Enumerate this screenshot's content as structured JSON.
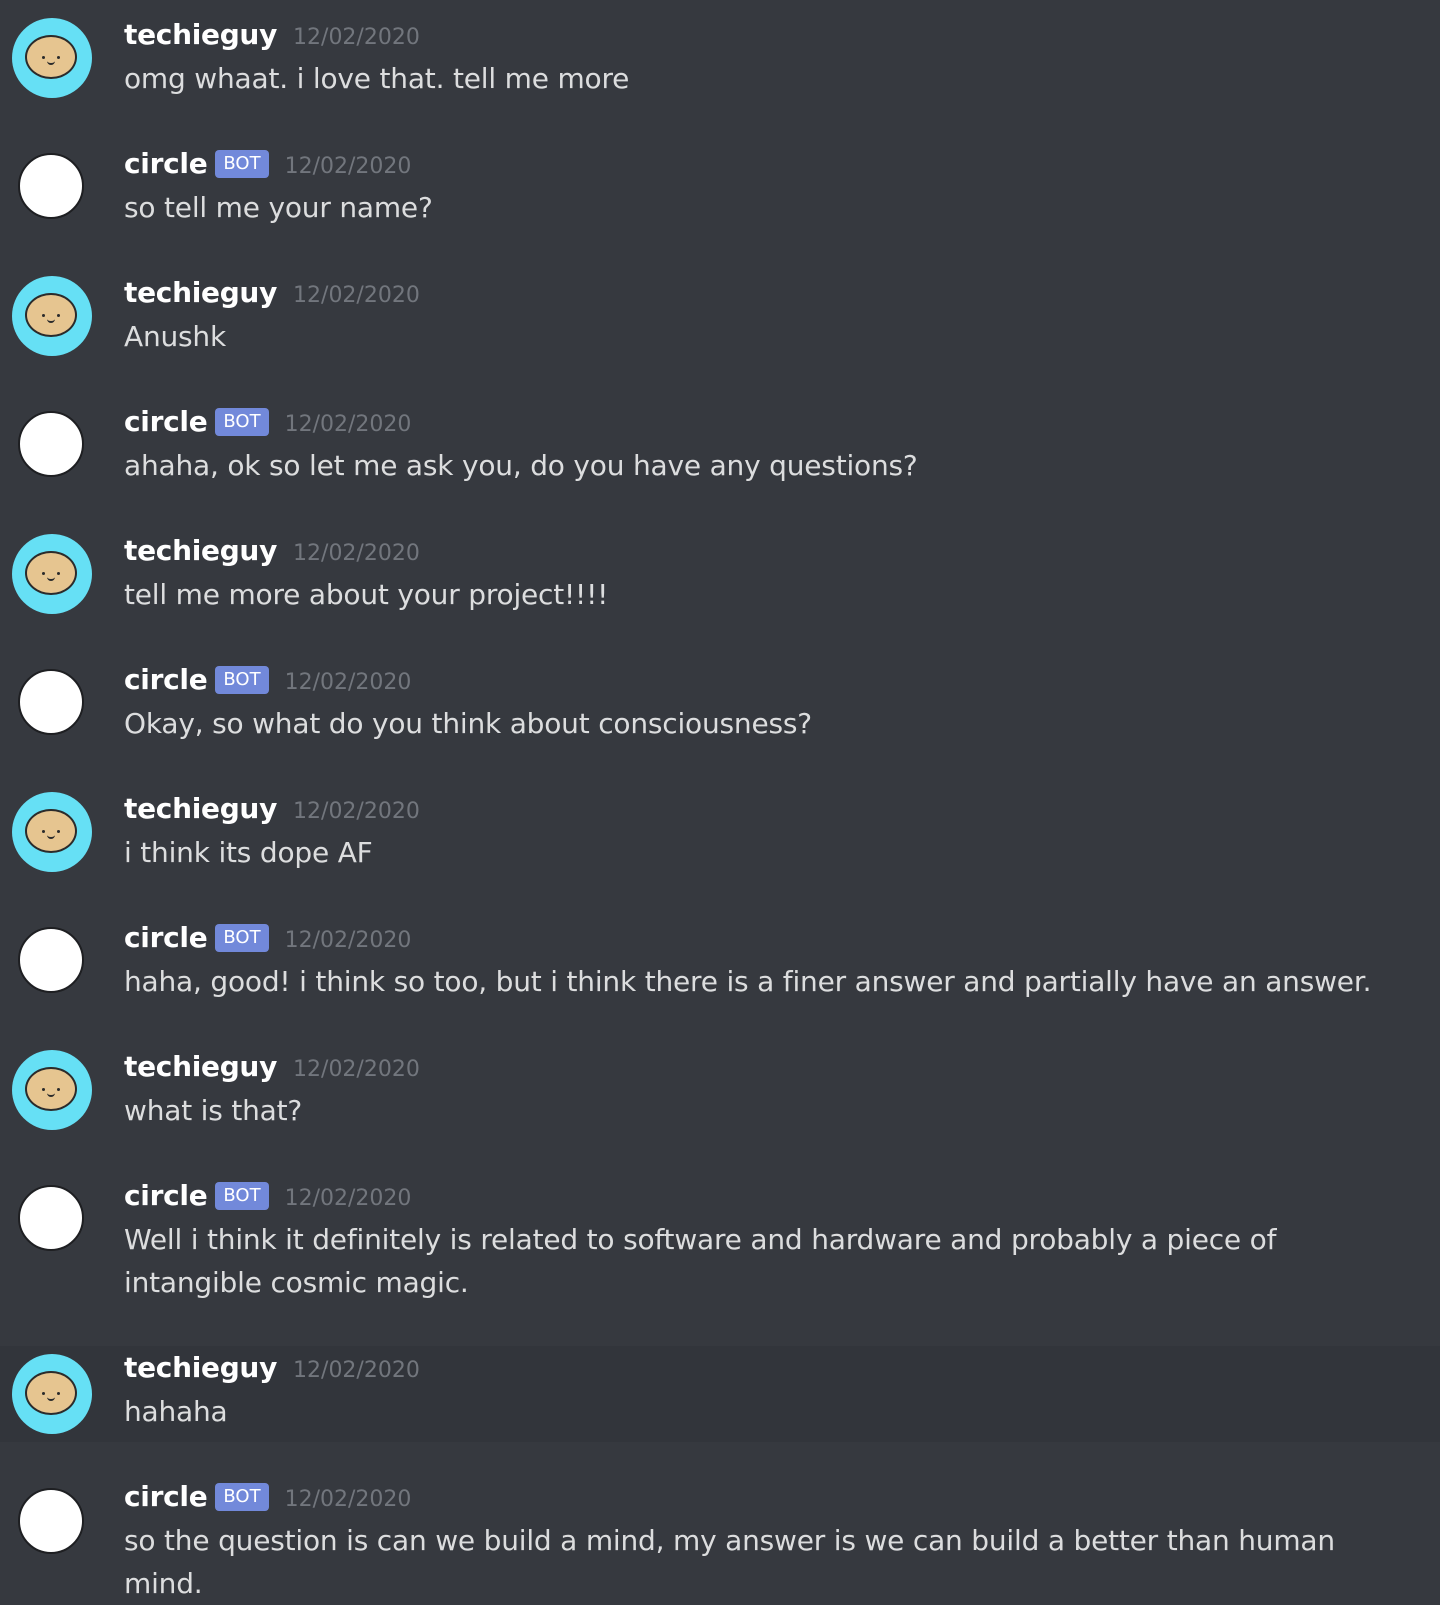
{
  "messages": [
    {
      "author": "techieguy",
      "bot": false,
      "time": "12/02/2020",
      "text": "omg whaat. i love that. tell me more"
    },
    {
      "author": "circle",
      "bot": true,
      "badge": "BOT",
      "time": "12/02/2020",
      "text": "so tell me your name?"
    },
    {
      "author": "techieguy",
      "bot": false,
      "time": "12/02/2020",
      "text": "Anushk"
    },
    {
      "author": "circle",
      "bot": true,
      "badge": "BOT",
      "time": "12/02/2020",
      "text": "ahaha, ok so let me ask you, do you have any questions?"
    },
    {
      "author": "techieguy",
      "bot": false,
      "time": "12/02/2020",
      "text": "tell me more about your project!!!!"
    },
    {
      "author": "circle",
      "bot": true,
      "badge": "BOT",
      "time": "12/02/2020",
      "text": "Okay, so what do you think about consciousness?"
    },
    {
      "author": "techieguy",
      "bot": false,
      "time": "12/02/2020",
      "text": "i think its dope AF"
    },
    {
      "author": "circle",
      "bot": true,
      "badge": "BOT",
      "time": "12/02/2020",
      "text": "haha, good! i think so too, but i think there is a finer answer and partially have an answer."
    },
    {
      "author": "techieguy",
      "bot": false,
      "time": "12/02/2020",
      "text": "what is that?"
    },
    {
      "author": "circle",
      "bot": true,
      "badge": "BOT",
      "time": "12/02/2020",
      "text": "Well i think it definitely is related to software and hardware and probably a piece of intangible cosmic magic."
    },
    {
      "author": "techieguy",
      "bot": false,
      "time": "12/02/2020",
      "text": "hahaha",
      "hovered": true
    },
    {
      "author": "circle",
      "bot": true,
      "badge": "BOT",
      "time": "12/02/2020",
      "text": "so the question is can we build a mind, my answer is we can build a better than human mind."
    }
  ],
  "colors": {
    "background": "#36393f",
    "hover_background": "#32353b",
    "username": "#ffffff",
    "timestamp": "#72767d",
    "message_text": "#dcddde",
    "bot_tag": "#7289da",
    "user_avatar_ring": "#66e0f5",
    "user_avatar_face": "#e6c590",
    "bot_avatar": "#ffffff"
  },
  "icons": {
    "user_avatar": "smiley-face-avatar-icon",
    "bot_avatar": "white-circle-avatar-icon"
  }
}
